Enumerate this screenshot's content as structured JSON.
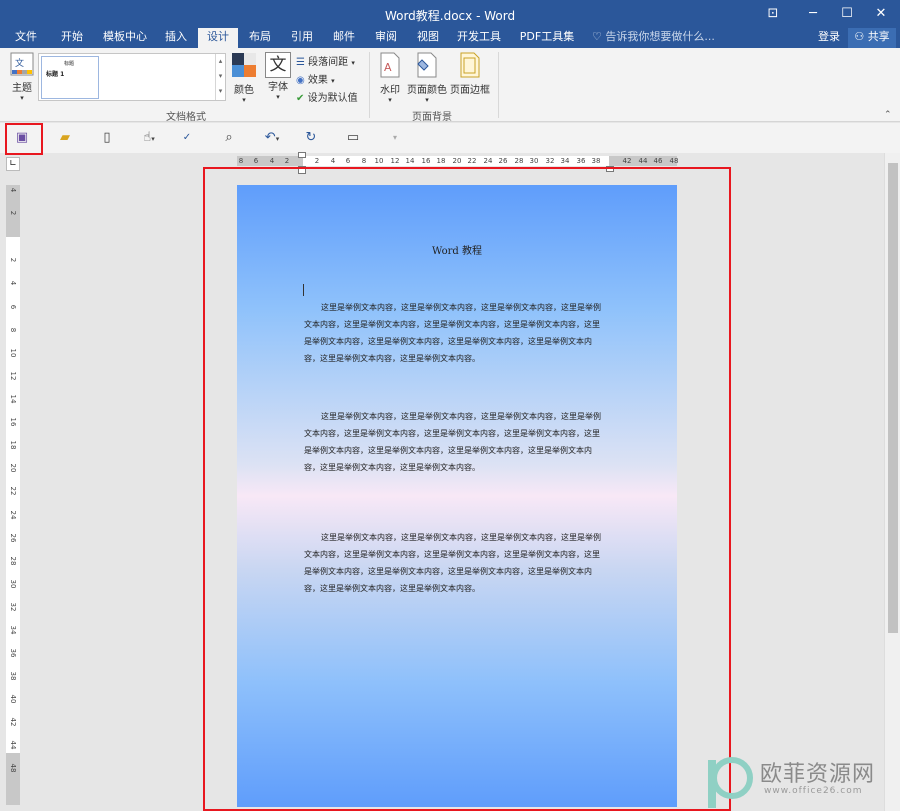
{
  "window": {
    "title": "Word教程.docx - Word"
  },
  "window_buttons": [
    "ribbon-options",
    "minimize",
    "maximize",
    "close"
  ],
  "menu": {
    "tabs": [
      "文件",
      "开始",
      "模板中心",
      "插入",
      "设计",
      "布局",
      "引用",
      "邮件",
      "审阅",
      "视图",
      "开发工具",
      "PDF工具集"
    ],
    "active_tab": "设计",
    "tell_me_placeholder": "告诉我你想要做什么...",
    "login": "登录",
    "share": "共享"
  },
  "ribbon": {
    "theme_label": "主题",
    "style_preview_title": "标题",
    "style_preview_heading": "标题 1",
    "colors_label": "颜色",
    "fonts_label": "字体",
    "paragraph_spacing_label": "段落间距",
    "effects_label": "效果",
    "set_default_label": "设为默认值",
    "group_doc_format": "文档格式",
    "watermark_label": "水印",
    "page_color_label": "页面颜色",
    "page_border_label": "页面边框",
    "group_page_background": "页面背景"
  },
  "ruler": {
    "horizontal_ticks": [
      "8",
      "6",
      "4",
      "2",
      "2",
      "4",
      "6",
      "8",
      "10",
      "12",
      "14",
      "16",
      "18",
      "20",
      "22",
      "24",
      "26",
      "28",
      "30",
      "32",
      "34",
      "36",
      "38",
      "42",
      "44",
      "46",
      "48"
    ],
    "vertical_ticks": [
      "4",
      "2",
      "2",
      "4",
      "6",
      "8",
      "10",
      "12",
      "14",
      "16",
      "18",
      "20",
      "22",
      "24",
      "26",
      "28",
      "30",
      "32",
      "34",
      "36",
      "38",
      "40",
      "42",
      "44",
      "48"
    ]
  },
  "document": {
    "title": "Word 教程",
    "paragraphs": [
      "这里是举例文本内容，这里是举例文本内容，这里是举例文本内容，这里是举例文本内容，这里是举例文本内容，这里是举例文本内容，这里是举例文本内容，这里是举例文本内容，这里是举例文本内容，这里是举例文本内容，这里是举例文本内容，这里是举例文本内容，这里是举例文本内容。",
      "这里是举例文本内容，这里是举例文本内容，这里是举例文本内容，这里是举例文本内容，这里是举例文本内容，这里是举例文本内容，这里是举例文本内容，这里是举例文本内容，这里是举例文本内容，这里是举例文本内容，这里是举例文本内容，这里是举例文本内容，这里是举例文本内容。",
      "这里是举例文本内容，这里是举例文本内容，这里是举例文本内容，这里是举例文本内容，这里是举例文本内容，这里是举例文本内容，这里是举例文本内容，这里是举例文本内容，这里是举例文本内容，这里是举例文本内容，这里是举例文本内容，这里是举例文本内容，这里是举例文本内容。"
    ]
  },
  "watermark": {
    "brand": "欧菲资源网",
    "url": "www.office26.com"
  },
  "colors": {
    "title_bar": "#2b579a",
    "highlight": "#e8171f",
    "page_gradient_top": "#5f9dfb",
    "page_gradient_mid": "#f8e8f6"
  }
}
